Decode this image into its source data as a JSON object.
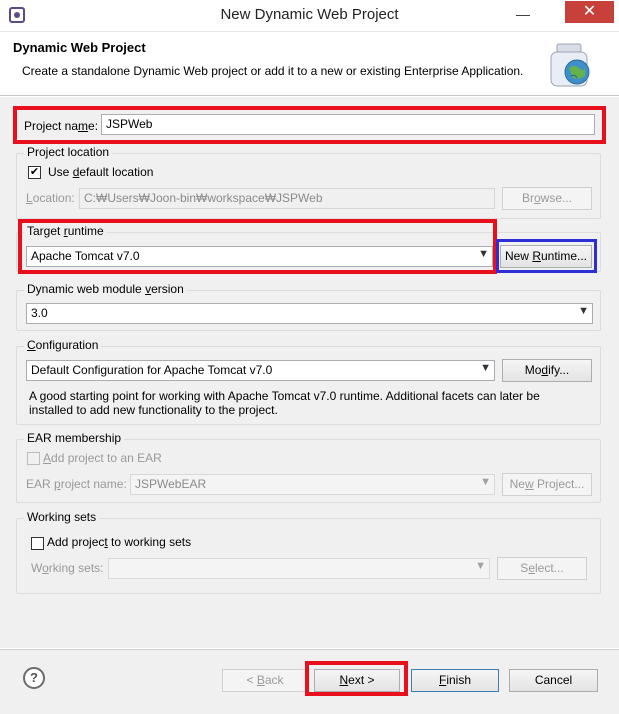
{
  "window": {
    "title": "New Dynamic Web Project",
    "minimize_glyph": "—",
    "close_glyph": "✕"
  },
  "banner": {
    "title": "Dynamic Web Project",
    "description": "Create a standalone Dynamic Web project or add it to a new or existing Enterprise Application."
  },
  "project_name": {
    "label_pre": "Project na",
    "label_u": "m",
    "label_post": "e:",
    "value": "JSPWeb"
  },
  "project_location": {
    "group_label": "Project location",
    "use_default_pre": "Use ",
    "use_default_u": "d",
    "use_default_post": "efault location",
    "use_default_checked": true,
    "location_label_pre": "",
    "location_label_u": "L",
    "location_label_post": "ocation:",
    "location_value": "C:₩Users₩Joon-bin₩workspace₩JSPWeb",
    "browse_pre": "Br",
    "browse_u": "o",
    "browse_post": "wse..."
  },
  "target_runtime": {
    "group_label_pre": "Target ",
    "group_label_u": "r",
    "group_label_post": "untime",
    "selected": "Apache Tomcat v7.0",
    "new_runtime_pre": "New ",
    "new_runtime_u": "R",
    "new_runtime_post": "untime..."
  },
  "module_version": {
    "group_label_pre": "Dynamic web module ",
    "group_label_u": "v",
    "group_label_post": "ersion",
    "selected": "3.0"
  },
  "configuration": {
    "group_label_pre": "",
    "group_label_u": "C",
    "group_label_post": "onfiguration",
    "selected": "Default Configuration for Apache Tomcat v7.0",
    "modify_pre": "Mo",
    "modify_u": "d",
    "modify_post": "ify...",
    "description": "A good starting point for working with Apache Tomcat v7.0 runtime. Additional facets can later be installed to add new functionality to the project."
  },
  "ear_membership": {
    "group_label": "EAR membership",
    "add_to_ear_pre": "",
    "add_to_ear_u": "A",
    "add_to_ear_post": "dd project to an EAR",
    "add_to_ear_checked": false,
    "ear_name_label_pre": "EAR ",
    "ear_name_label_u": "p",
    "ear_name_label_post": "roject name:",
    "ear_name_value": "JSPWebEAR",
    "new_project_pre": "Ne",
    "new_project_u": "w",
    "new_project_post": " Project..."
  },
  "working_sets": {
    "group_label": "Working sets",
    "add_pre": "Add projec",
    "add_u": "t",
    "add_post": " to working sets",
    "add_checked": false,
    "label_pre": "W",
    "label_u": "o",
    "label_post": "rking sets:",
    "value": "",
    "select_pre": "S",
    "select_u": "e",
    "select_post": "lect..."
  },
  "footer": {
    "help_glyph": "?",
    "back_pre": "< ",
    "back_u": "B",
    "back_post": "ack",
    "next_pre": "",
    "next_u": "N",
    "next_post": "ext >",
    "finish_pre": "",
    "finish_u": "F",
    "finish_post": "inish",
    "cancel": "Cancel"
  },
  "colors": {
    "highlight_red": "#e8101c",
    "highlight_blue": "#2e2ed6",
    "close_button": "#c7403a"
  }
}
